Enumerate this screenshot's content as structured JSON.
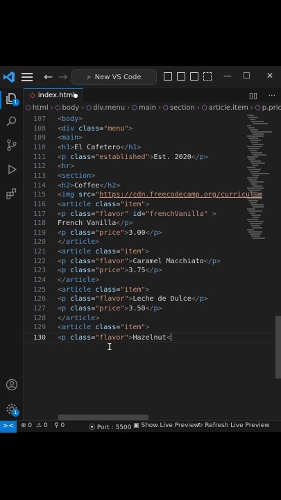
{
  "titlebar": {
    "logo": "vscode-logo",
    "back": "←",
    "forward": "→",
    "search_text": "New VS Code"
  },
  "window": {
    "minimize": "—",
    "maximize": "☐",
    "close": "✕"
  },
  "activity": {
    "explorer_badge": "1",
    "manage_badge": "1"
  },
  "tab": {
    "label": "index.html"
  },
  "breadcrumb": [
    "html",
    "body",
    "div.menu",
    "main",
    "section",
    "article.item",
    "p.price"
  ],
  "editor": {
    "lines": [
      {
        "n": "107",
        "indent": "",
        "html": "<body>"
      },
      {
        "n": "108",
        "indent": "",
        "html": "<div class=\"menu\">"
      },
      {
        "n": "109",
        "indent": "",
        "html": "<main>"
      },
      {
        "n": "110",
        "indent": "",
        "html": "<h1>El Cafetero</h1>"
      },
      {
        "n": "111",
        "indent": "",
        "html": "<p class=\"established\">Est. 2020</p>"
      },
      {
        "n": "112",
        "indent": "",
        "html": "<hr>"
      },
      {
        "n": "113",
        "indent": "",
        "html": "<section>"
      },
      {
        "n": "114",
        "indent": "",
        "html": "<h2>Coffee</h2>"
      },
      {
        "n": "115",
        "indent": "",
        "html": "<img src=\"https://cdn.freecodecamp.org/curriculum"
      },
      {
        "n": "116",
        "indent": "",
        "html": "<article class=\"item\">"
      },
      {
        "n": "117",
        "indent": "",
        "html": "<p class=\"flavor\" id=\"frenchVanilla\" >"
      },
      {
        "n": "118",
        "indent": "",
        "html": "French Vanilla</p>"
      },
      {
        "n": "119",
        "indent": "",
        "html": "<p class=\"price\">3.00</p>"
      },
      {
        "n": "120",
        "indent": "",
        "html": "</article>"
      },
      {
        "n": "121",
        "indent": "",
        "html": "<article class=\"item\">"
      },
      {
        "n": "122",
        "indent": "",
        "html": "<p class=\"flavor\">Caramel Macchiato</p>"
      },
      {
        "n": "123",
        "indent": "",
        "html": "<p class=\"price\">3.75</p>"
      },
      {
        "n": "124",
        "indent": "",
        "html": "</article>"
      },
      {
        "n": "125",
        "indent": "",
        "html": "<article class=\"item\">"
      },
      {
        "n": "126",
        "indent": "",
        "html": "<p class=\"flavor\">Leche de Dulce</p>"
      },
      {
        "n": "127",
        "indent": "",
        "html": "<p class=\"price\">3.50</p>"
      },
      {
        "n": "128",
        "indent": "",
        "html": "</article>"
      },
      {
        "n": "129",
        "indent": "",
        "html": "<article class=\"item\">"
      },
      {
        "n": "130",
        "indent": "",
        "html": "<p class=\"flavor\">Hazelnut<"
      }
    ],
    "current_line": "130"
  },
  "status": {
    "remote": "><",
    "errors": "0",
    "warnings": "0",
    "ports": "0",
    "port": "Port : 5500",
    "show_preview": "Show Live Preview",
    "refresh_preview": "Refresh Live Preview"
  }
}
